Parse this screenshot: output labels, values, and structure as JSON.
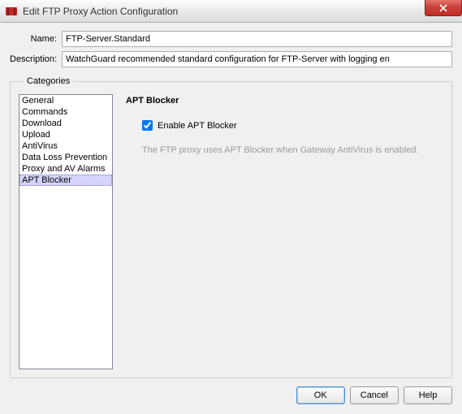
{
  "window": {
    "title": "Edit FTP Proxy Action Configuration"
  },
  "form": {
    "name_label": "Name:",
    "name_value": "FTP-Server.Standard",
    "description_label": "Description:",
    "description_value": "WatchGuard recommended standard configuration for FTP-Server with logging en"
  },
  "categories": {
    "legend": "Categories",
    "items": [
      {
        "label": "General",
        "selected": false
      },
      {
        "label": "Commands",
        "selected": false
      },
      {
        "label": "Download",
        "selected": false
      },
      {
        "label": "Upload",
        "selected": false
      },
      {
        "label": "AntiVirus",
        "selected": false
      },
      {
        "label": "Data Loss Prevention",
        "selected": false
      },
      {
        "label": "Proxy and AV Alarms",
        "selected": false
      },
      {
        "label": "APT Blocker",
        "selected": true
      }
    ]
  },
  "panel": {
    "title": "APT Blocker",
    "checkbox_label": "Enable APT Blocker",
    "checkbox_checked": true,
    "note": "The FTP proxy uses APT Blocker when Gateway AntiVirus is enabled."
  },
  "buttons": {
    "ok": "OK",
    "cancel": "Cancel",
    "help": "Help"
  }
}
